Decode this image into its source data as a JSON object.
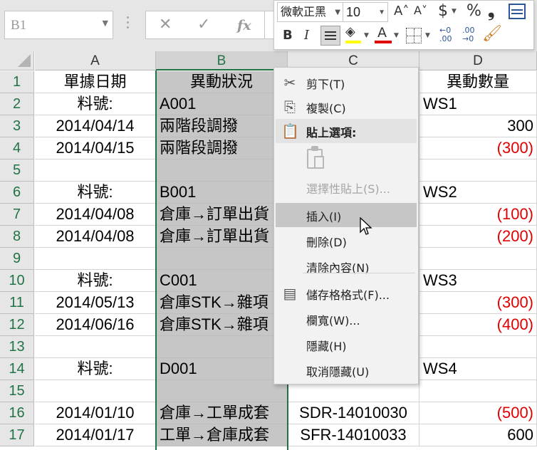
{
  "formula_bar": {
    "name_box": "B1",
    "cancel_icon": "✕",
    "enter_icon": "✓",
    "fx_label": "fx"
  },
  "columns": [
    "A",
    "B",
    "C",
    "D"
  ],
  "rows": [
    {
      "num": "1",
      "a": "單據日期",
      "b": "異動狀況",
      "c": "",
      "d": "異動數量",
      "d_red": false
    },
    {
      "num": "2",
      "a": "料號:",
      "b": "A001",
      "c": "",
      "d": "WS1",
      "d_red": false
    },
    {
      "num": "3",
      "a": "2014/04/14",
      "b": "兩階段調撥",
      "c": "",
      "d": "300",
      "d_red": false
    },
    {
      "num": "4",
      "a": "2014/04/15",
      "b": "兩階段調撥",
      "c": "",
      "d": "(300)",
      "d_red": true
    },
    {
      "num": "5",
      "a": "",
      "b": "",
      "c": "",
      "d": "",
      "d_red": false
    },
    {
      "num": "6",
      "a": "料號:",
      "b": "B001",
      "c": "",
      "d": "WS2",
      "d_red": false
    },
    {
      "num": "7",
      "a": "2014/04/08",
      "b": "倉庫→訂單出貨",
      "c": "",
      "d": "(100)",
      "d_red": true
    },
    {
      "num": "8",
      "a": "2014/04/08",
      "b": "倉庫→訂單出貨",
      "c": "",
      "d": "(200)",
      "d_red": true
    },
    {
      "num": "9",
      "a": "",
      "b": "",
      "c": "",
      "d": "",
      "d_red": false
    },
    {
      "num": "10",
      "a": "料號:",
      "b": "C001",
      "c": "",
      "d": "WS3",
      "d_red": false
    },
    {
      "num": "11",
      "a": "2014/05/13",
      "b": "倉庫STK→雜項",
      "c": "",
      "d": "(300)",
      "d_red": true
    },
    {
      "num": "12",
      "a": "2014/06/16",
      "b": "倉庫STK→雜項",
      "c": "",
      "d": "(400)",
      "d_red": true
    },
    {
      "num": "13",
      "a": "",
      "b": "",
      "c": "",
      "d": "",
      "d_red": false
    },
    {
      "num": "14",
      "a": "料號:",
      "b": "D001",
      "c": "",
      "d": "WS4",
      "d_red": false
    },
    {
      "num": "15",
      "a": "",
      "b": "",
      "c": "",
      "d": "",
      "d_red": false
    },
    {
      "num": "16",
      "a": "2014/01/10",
      "b": "倉庫→工單成套",
      "c": "SDR-14010030",
      "d": "(500)",
      "d_red": true
    },
    {
      "num": "17",
      "a": "2014/01/17",
      "b": "工單→倉庫成套",
      "c": "SFR-14010033",
      "d": "600",
      "d_red": false
    }
  ],
  "mini_toolbar": {
    "font_name": "微軟正黑",
    "font_size": "10",
    "grow_font": "A˄",
    "shrink_font": "A˅",
    "currency": "$",
    "percent": "%",
    "comma": "❟",
    "bold": "B",
    "italic": "I",
    "font_color_letter": "A",
    "increase_decimal": "←0 .00",
    "decrease_decimal": ".00 →0",
    "fill_color": "#ffff00",
    "font_color": "#e00000"
  },
  "context_menu": {
    "items": [
      {
        "label": "剪下(T)",
        "icon": "scissors-icon",
        "glyph": "✂",
        "disabled": false,
        "highlighted": false
      },
      {
        "label": "複製(C)",
        "icon": "copy-icon",
        "glyph": "⎘",
        "disabled": false,
        "highlighted": false
      },
      {
        "label": "貼上選項:",
        "icon": "paste-options-icon",
        "glyph": "📋",
        "disabled": false,
        "header": true
      },
      {
        "label": "選擇性貼上(S)...",
        "icon": "",
        "glyph": "",
        "disabled": true,
        "highlighted": false
      },
      {
        "label": "插入(I)",
        "icon": "",
        "glyph": "",
        "disabled": false,
        "highlighted": true
      },
      {
        "label": "刪除(D)",
        "icon": "",
        "glyph": "",
        "disabled": false,
        "highlighted": false
      },
      {
        "label": "清除內容(N)",
        "icon": "",
        "glyph": "",
        "disabled": false,
        "highlighted": false
      },
      {
        "label": "儲存格格式(F)...",
        "icon": "format-cells-icon",
        "glyph": "▤",
        "disabled": false,
        "highlighted": false
      },
      {
        "label": "欄寬(W)...",
        "icon": "",
        "glyph": "",
        "disabled": false,
        "highlighted": false
      },
      {
        "label": "隱藏(H)",
        "icon": "",
        "glyph": "",
        "disabled": false,
        "highlighted": false
      },
      {
        "label": "取消隱藏(U)",
        "icon": "",
        "glyph": "",
        "disabled": false,
        "highlighted": false
      }
    ]
  }
}
